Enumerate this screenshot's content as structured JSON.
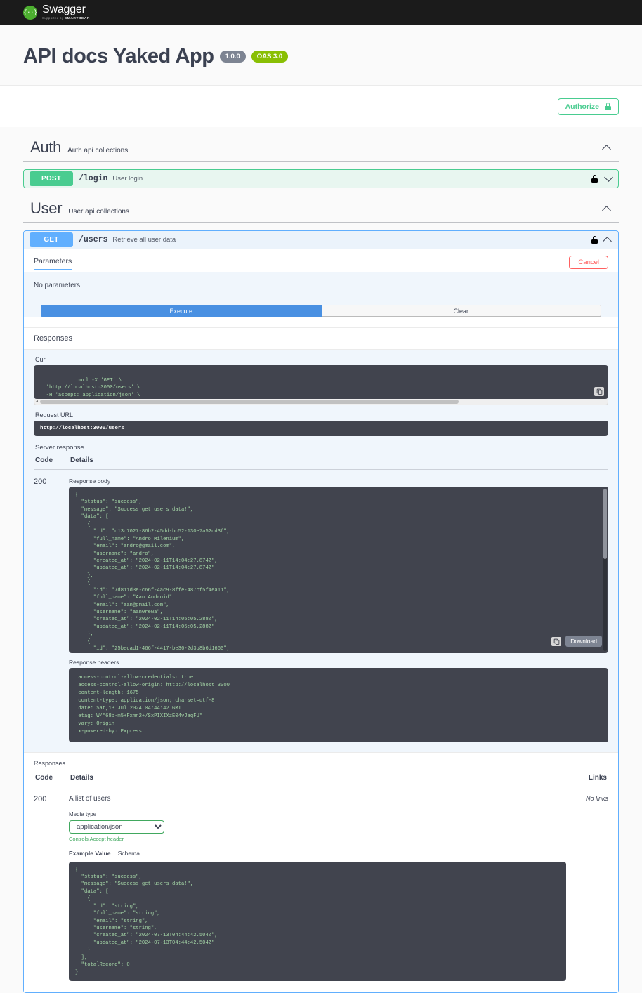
{
  "topbar": {
    "logo_name": "Swagger",
    "logo_sub_prefix": "Supported by ",
    "logo_sub_brand": "SMARTBEAR",
    "logo_glyph": "{··}"
  },
  "header": {
    "title": "API docs Yaked App",
    "version_badge": "1.0.0",
    "oas_badge": "OAS 3.0",
    "authorize_label": "Authorize"
  },
  "sections": [
    {
      "title": "Auth",
      "description": "Auth api collections",
      "operations": [
        {
          "method": "POST",
          "path": "/login",
          "summary": "User login"
        }
      ]
    },
    {
      "title": "User",
      "description": "User api collections",
      "operations": [
        {
          "method": "GET",
          "path": "/users",
          "summary": "Retrieve all user data"
        }
      ]
    }
  ],
  "operation": {
    "tab_parameters": "Parameters",
    "cancel_label": "Cancel",
    "no_parameters": "No parameters",
    "execute_label": "Execute",
    "clear_label": "Clear",
    "responses_label": "Responses",
    "curl_label": "Curl",
    "curl_command": "curl -X 'GET' \\\n  'http://localhost:3000/users' \\\n  -H 'accept: application/json' \\\n  -H 'Authorization: Bearer eyJhbGciOiJIUzI1NiIsInR5cCI6IkpXVCJ9.eyJpZCI6ImQxM2M3MDI3LTg2YjItNDVkZC1iYzUyLTEzMGU3YTUyZGQzZiIsImVtYWlsIjoiYW5kcm9AZ21haWwuY29tIiwid XNlcm5hbWUiOiJhbmRybyIsImlhdCI6MTcyMDg0NTc3Mywi",
    "request_url_label": "Request URL",
    "request_url": "http://localhost:3000/users",
    "server_response_label": "Server response",
    "table_headers": {
      "code": "Code",
      "details": "Details",
      "links": "Links"
    },
    "server_code": "200",
    "response_body_label": "Response body",
    "response_body": "{\n  \"status\": \"success\",\n  \"message\": \"Success get users data!\",\n  \"data\": [\n    {\n      \"id\": \"d13c7027-86b2-45dd-bc52-130e7a52dd3f\",\n      \"full_name\": \"Andro Milenium\",\n      \"email\": \"andro@gmail.com\",\n      \"username\": \"andro\",\n      \"created_at\": \"2024-02-11T14:04:27.874Z\",\n      \"updated_at\": \"2024-02-11T14:04:27.874Z\"\n    },\n    {\n      \"id\": \"7d811d3e-c66f-4ac9-8ffe-487cf5f4ea11\",\n      \"full_name\": \"Aan Android\",\n      \"email\": \"aan@gmail.com\",\n      \"username\": \"aan0rewa\",\n      \"created_at\": \"2024-02-11T14:05:05.288Z\",\n      \"updated_at\": \"2024-02-11T14:05:05.288Z\"\n    },\n    {\n      \"id\": \"25becad1-466f-4417-be36-2d3b8b6d1660\",\n      \"full_name\": \"Ucup Ceking\",\n      \"email\": \"kuphroy@gmail.com\",\n      \"username\": \"ucup\",\n      \"created_at\": \"2024-02-11T14:21:02.833Z\",\n      \"updated_at\": \"2024-02-11T14:21:02.833Z\"",
    "download_label": "Download",
    "response_headers_label": "Response headers",
    "response_headers": " access-control-allow-credentials: true \n access-control-allow-origin: http://localhost:3000 \n content-length: 1675 \n content-type: application/json; charset=utf-8 \n date: Sat,13 Jul 2024 04:44:42 GMT \n etag: W/\"68b-m5+Fxmn2+/SxPIXIXzE04vJaqFU\" \n vary: Origin \n x-powered-by: Express ",
    "responses2_label": "Responses",
    "response_200_code": "200",
    "response_200_description": "A list of users",
    "no_links": "No links",
    "media_type_label": "Media type",
    "media_type_value": "application/json",
    "controls_accept": "Controls Accept header.",
    "example_value_tab": "Example Value",
    "schema_tab": "Schema",
    "example_value": "{\n  \"status\": \"success\",\n  \"message\": \"Success get users data!\",\n  \"data\": [\n    {\n      \"id\": \"string\",\n      \"full_name\": \"string\",\n      \"email\": \"string\",\n      \"username\": \"string\",\n      \"created_at\": \"2024-07-13T04:44:42.504Z\",\n      \"updated_at\": \"2024-07-13T04:44:42.504Z\"\n    }\n  ],\n  \"totalRecord\": 0\n}"
  },
  "colors": {
    "get": "#61affe",
    "post": "#49cc90",
    "oas": "#89bf04",
    "version": "#7d8492",
    "cancel": "#ff6060",
    "execute": "#4990e2",
    "code_bg": "#41444e"
  }
}
